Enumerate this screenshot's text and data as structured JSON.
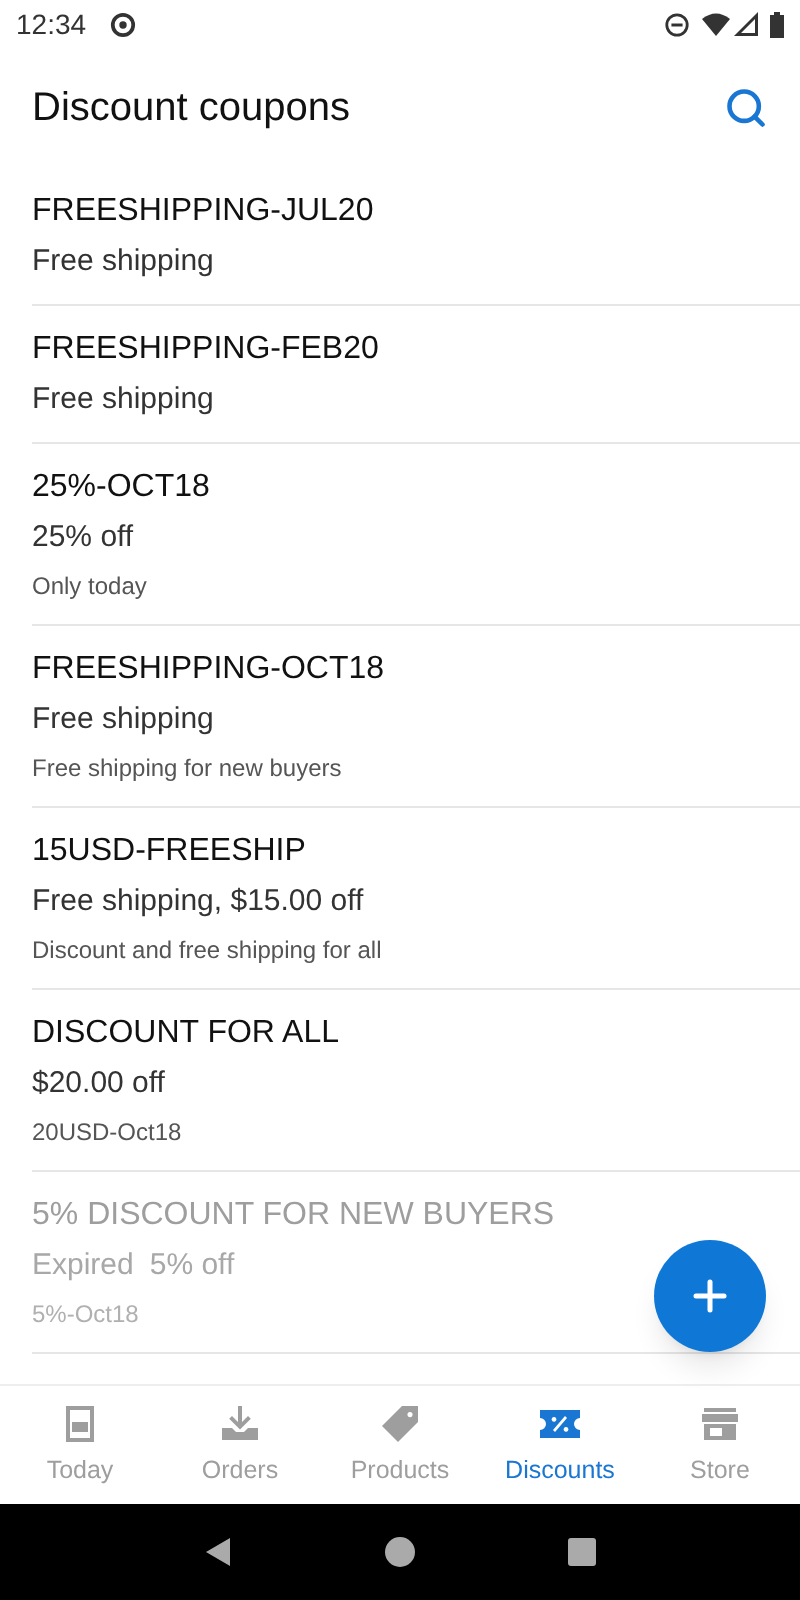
{
  "status_bar": {
    "time": "12:34"
  },
  "header": {
    "title": "Discount coupons"
  },
  "coupons": [
    {
      "code": "FREESHIPPING-JUL20",
      "summary": "Free shipping",
      "expired": false
    },
    {
      "code": "FREESHIPPING-FEB20",
      "summary": "Free shipping",
      "expired": false
    },
    {
      "code": "25%-OCT18",
      "summary": "25% off",
      "note": "Only today",
      "expired": false
    },
    {
      "code": "FREESHIPPING-OCT18",
      "summary": "Free shipping",
      "note": "Free shipping for new buyers",
      "expired": false
    },
    {
      "code": "15USD-FREESHIP",
      "summary": "Free shipping, $15.00 off",
      "note": "Discount and free shipping for all",
      "expired": false
    },
    {
      "code": "DISCOUNT FOR ALL",
      "summary": "$20.00 off",
      "note": "20USD-Oct18",
      "expired": false
    },
    {
      "code": "5% DISCOUNT FOR NEW BUYERS",
      "status": "Expired",
      "summary": "5% off",
      "note": "5%-Oct18",
      "expired": true
    }
  ],
  "tabs": [
    {
      "kind": "today",
      "label": "Today",
      "selected": false
    },
    {
      "kind": "orders",
      "label": "Orders",
      "selected": false
    },
    {
      "kind": "products",
      "label": "Products",
      "selected": false
    },
    {
      "kind": "discounts",
      "label": "Discounts",
      "selected": true
    },
    {
      "kind": "store",
      "label": "Store",
      "selected": false
    }
  ]
}
